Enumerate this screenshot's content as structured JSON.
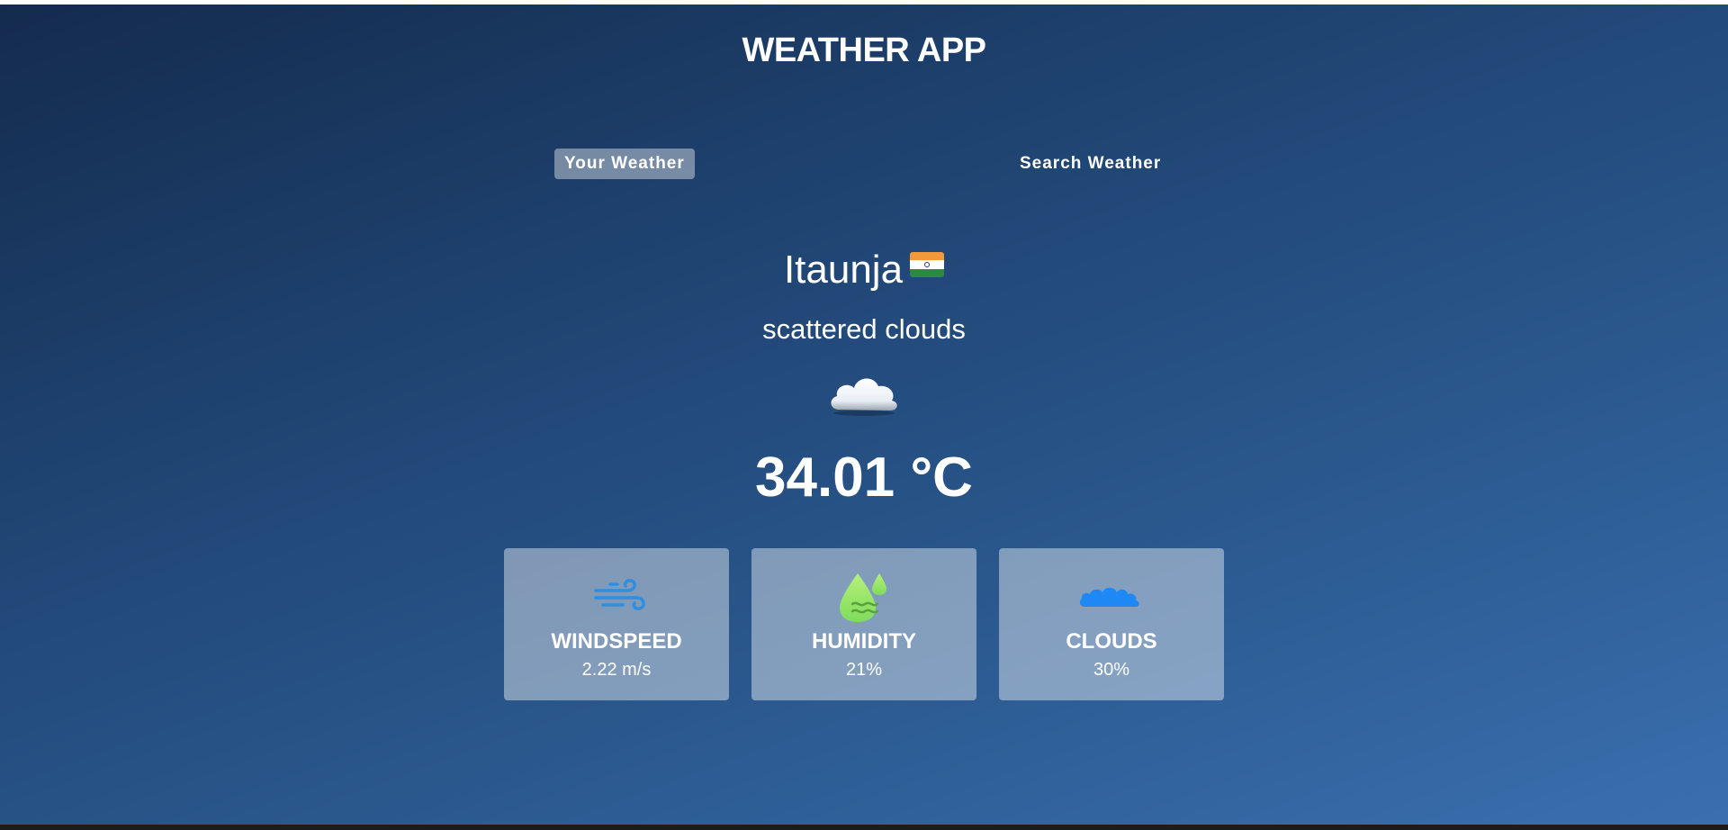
{
  "app": {
    "title": "WEATHER APP"
  },
  "tabs": [
    {
      "label": "Your Weather",
      "active": true
    },
    {
      "label": "Search Weather",
      "active": false
    }
  ],
  "weather": {
    "city": "Itaunja",
    "country_flag": "india-flag-icon",
    "description": "scattered clouds",
    "condition_icon": "cloud-icon",
    "temperature": "34.01 °C"
  },
  "stats": [
    {
      "label": "WINDSPEED",
      "value": "2.22 m/s",
      "icon": "wind-icon"
    },
    {
      "label": "HUMIDITY",
      "value": "21%",
      "icon": "humidity-drops-icon"
    },
    {
      "label": "CLOUDS",
      "value": "30%",
      "icon": "clouds-icon"
    }
  ],
  "colors": {
    "background_top": "#142b4d",
    "background_bottom": "#3a6faf",
    "card": "rgba(255,255,255,0.42)",
    "wind_icon": "#2f8ee0",
    "humidity_icon": "#9bea6a",
    "clouds_icon": "#1e88f5"
  }
}
